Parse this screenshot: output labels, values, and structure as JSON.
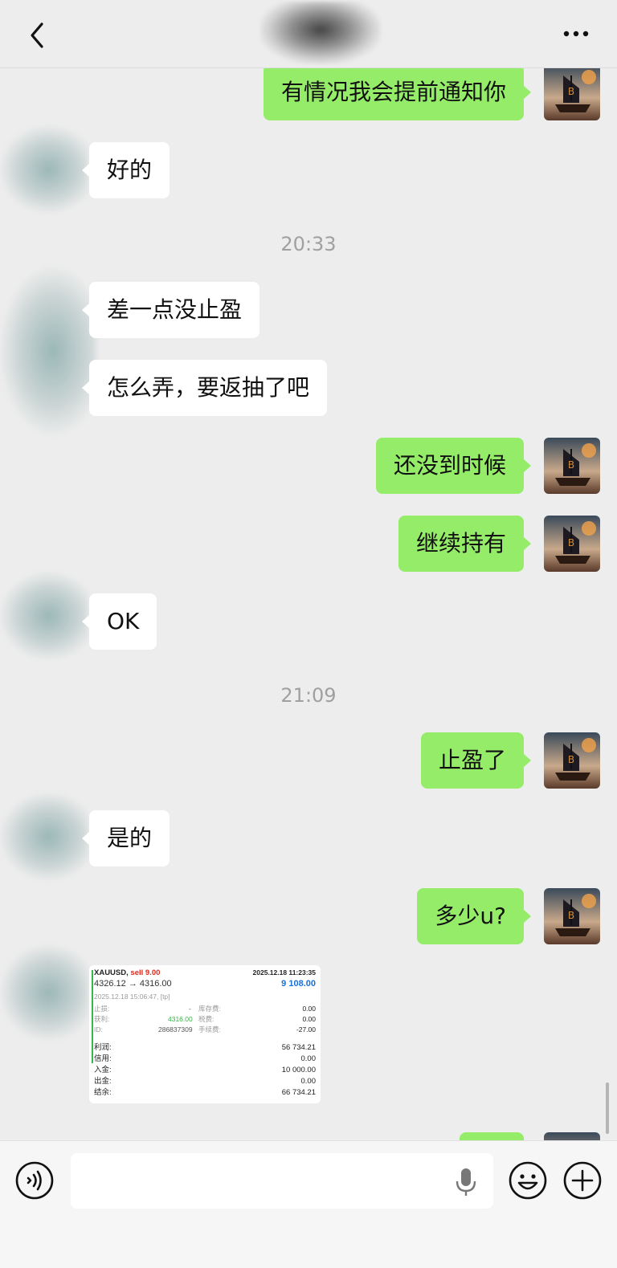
{
  "header": {
    "title": "",
    "back_icon": "chevron-left-icon",
    "more_icon": "more-dots-icon"
  },
  "messages": [
    {
      "side": "right",
      "text": "有情况我会提前通知你"
    },
    {
      "side": "left",
      "text": "好的"
    },
    {
      "type": "time",
      "text": "20:33"
    },
    {
      "side": "left",
      "text": "差一点没止盈"
    },
    {
      "side": "left",
      "text": "怎么弄，要返抽了吧"
    },
    {
      "side": "right",
      "text": "还没到时候"
    },
    {
      "side": "right",
      "text": "继续持有"
    },
    {
      "side": "left",
      "text": "OK"
    },
    {
      "type": "time",
      "text": "21:09"
    },
    {
      "side": "right",
      "text": "止盈了"
    },
    {
      "side": "left",
      "text": "是的"
    },
    {
      "side": "right",
      "text": "多少u?"
    }
  ],
  "trade_card": {
    "symbol": "XAUUSD,",
    "side": "sell 9.00",
    "close_time": "2025.12.18 11:23:35",
    "prices": "4326.12 → 4316.00",
    "profit": "9 108.00",
    "open_info": "2025.12.18 15:06:47, [tp]",
    "stop_loss_label": "止损:",
    "stop_loss": "-",
    "swap_label": "库存费:",
    "swap": "0.00",
    "take_profit_label": "获利:",
    "take_profit": "4316.00",
    "tax_label": "税费:",
    "tax": "0.00",
    "id_label": "ID:",
    "id": "286837309",
    "commission_label": "手续费:",
    "commission": "-27.00",
    "summary": [
      {
        "label": "利润:",
        "value": "56 734.21"
      },
      {
        "label": "信用:",
        "value": "0.00"
      },
      {
        "label": "入金:",
        "value": "10 000.00"
      },
      {
        "label": "出金:",
        "value": "0.00"
      },
      {
        "label": "结余:",
        "value": "66 734.21"
      }
    ]
  },
  "input_bar": {
    "voice_icon": "voice-icon",
    "mic_icon": "microphone-icon",
    "emoji_icon": "emoji-icon",
    "plus_icon": "plus-icon"
  },
  "colors": {
    "background": "#ededed",
    "my_bubble": "#95ec69",
    "their_bubble": "#ffffff",
    "timestamp": "#a0a0a0",
    "profit_green": "#39b54a",
    "sell_red": "#e0281c",
    "profit_blue": "#1a6fd6"
  }
}
